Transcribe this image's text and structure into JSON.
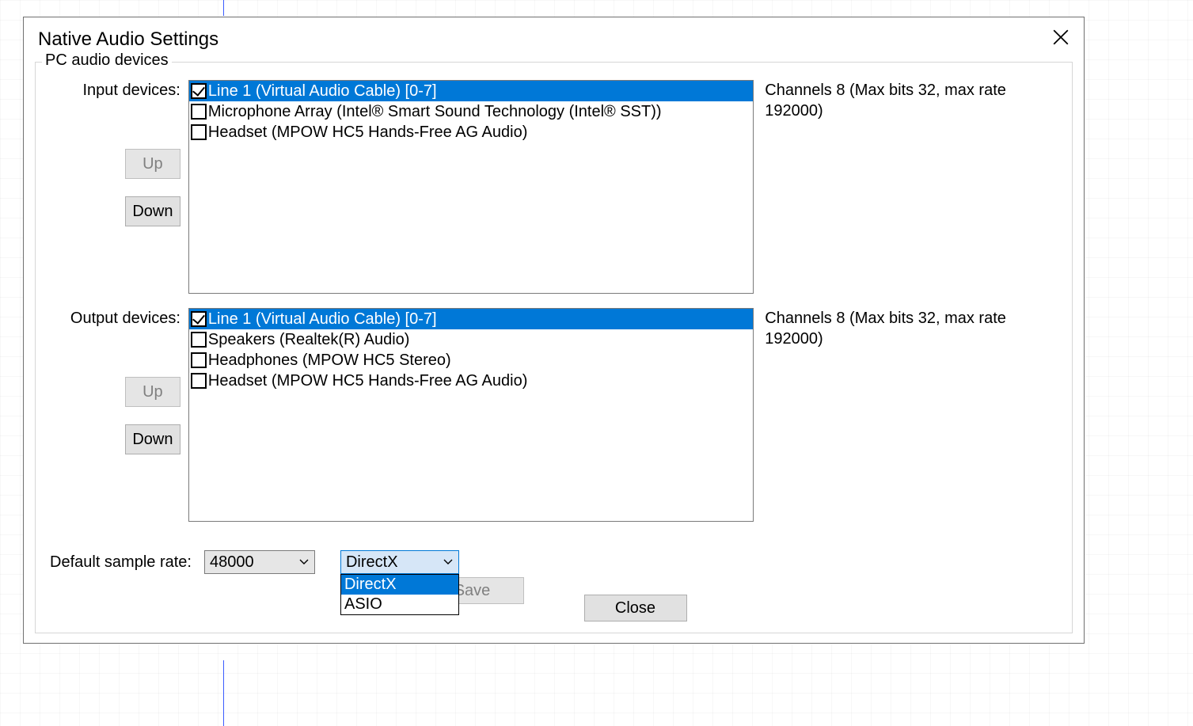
{
  "dialog": {
    "title": "Native Audio Settings",
    "group_legend": "PC audio devices",
    "sections": {
      "input": {
        "label": "Input devices:",
        "up_label": "Up",
        "down_label": "Down",
        "items": [
          {
            "label": "Line 1 (Virtual Audio Cable) [0-7]",
            "checked": true,
            "selected": true
          },
          {
            "label": "Microphone Array (Intel® Smart Sound Technology (Intel® SST))",
            "checked": false,
            "selected": false
          },
          {
            "label": "Headset (MPOW HC5 Hands-Free AG Audio)",
            "checked": false,
            "selected": false
          }
        ],
        "info": "Channels 8 (Max bits 32, max rate 192000)"
      },
      "output": {
        "label": "Output devices:",
        "up_label": "Up",
        "down_label": "Down",
        "items": [
          {
            "label": "Line 1 (Virtual Audio Cable) [0-7]",
            "checked": true,
            "selected": true
          },
          {
            "label": "Speakers (Realtek(R) Audio)",
            "checked": false,
            "selected": false
          },
          {
            "label": "Headphones (MPOW HC5 Stereo)",
            "checked": false,
            "selected": false
          },
          {
            "label": "Headset (MPOW HC5 Hands-Free AG Audio)",
            "checked": false,
            "selected": false
          }
        ],
        "info": "Channels 8 (Max bits 32, max rate 192000)"
      }
    },
    "sample_rate": {
      "label": "Default sample rate:",
      "value": "48000"
    },
    "api_select": {
      "value": "DirectX",
      "options": [
        "DirectX",
        "ASIO"
      ],
      "open": true,
      "highlighted_index": 0
    },
    "buttons": {
      "save": "Save",
      "close": "Close"
    }
  }
}
